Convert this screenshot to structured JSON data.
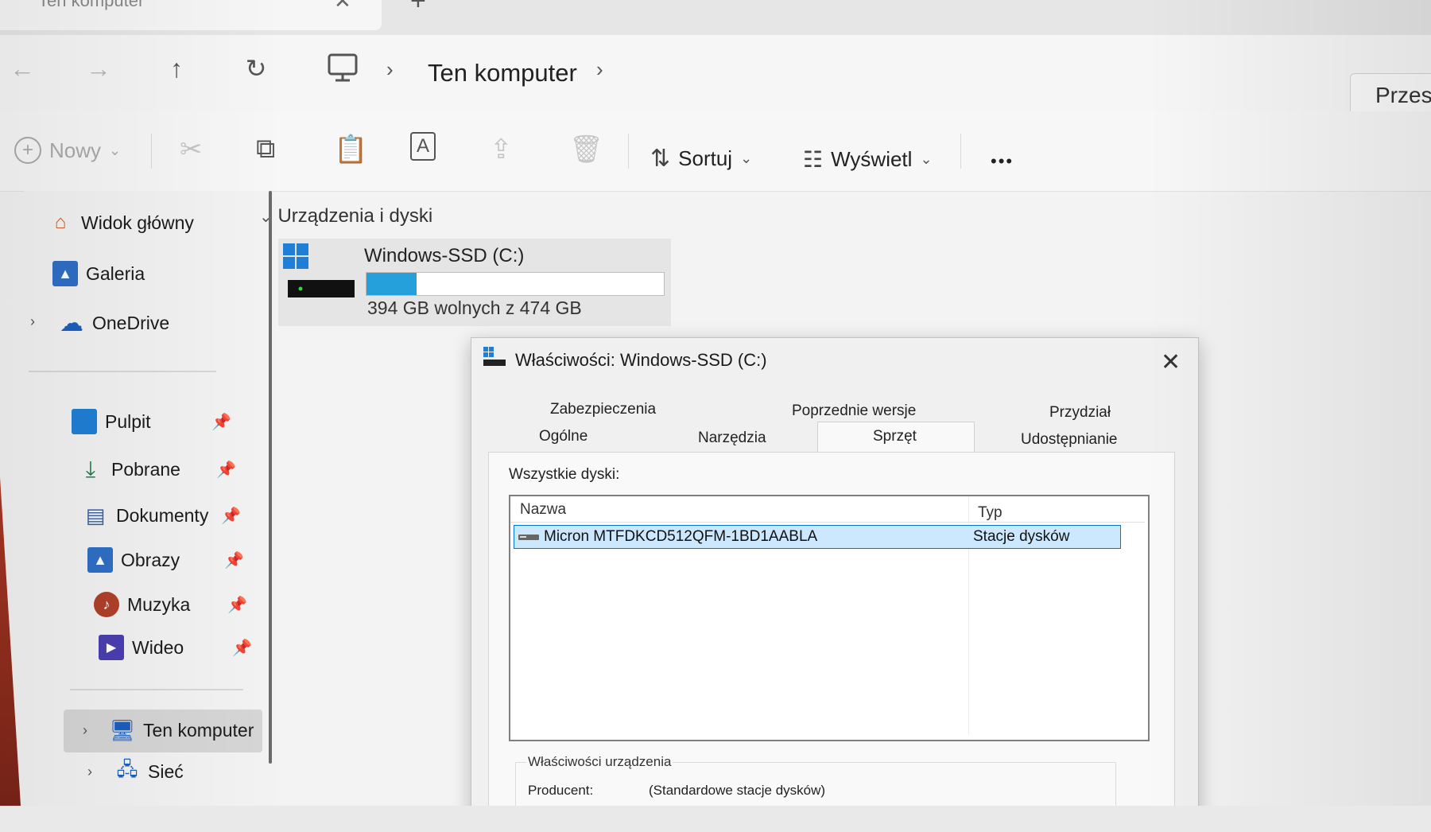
{
  "window": {
    "tab_title": "Ten komputer",
    "tab_close": "✕",
    "tab_add": "+"
  },
  "nav": {
    "back": "←",
    "forward": "→",
    "up": "↑",
    "refresh": "↻",
    "breadcrumb_sep": "›",
    "breadcrumb_label": "Ten komputer",
    "search_placeholder": "Przesz"
  },
  "commands": {
    "new_label": "Nowy",
    "sort_label": "Sortuj",
    "view_label": "Wyświetl",
    "more_label": "•••",
    "chevron": "⌄"
  },
  "sidebar": {
    "top": [
      {
        "label": "Widok główny",
        "icon": "home-icon"
      },
      {
        "label": "Galeria",
        "icon": "gallery-icon"
      },
      {
        "label": "OneDrive",
        "icon": "cloud-icon"
      }
    ],
    "pinned": [
      {
        "label": "Pulpit",
        "icon": "desktop-folder-icon"
      },
      {
        "label": "Pobrane",
        "icon": "download-icon"
      },
      {
        "label": "Dokumenty",
        "icon": "documents-icon"
      },
      {
        "label": "Obrazy",
        "icon": "pictures-icon"
      },
      {
        "label": "Muzyka",
        "icon": "music-icon"
      },
      {
        "label": "Wideo",
        "icon": "video-icon"
      }
    ],
    "bottom": [
      {
        "label": "Ten komputer",
        "icon": "computer-icon"
      },
      {
        "label": "Sieć",
        "icon": "network-icon"
      }
    ],
    "pin_glyph": "📌",
    "expand_glyph": "›"
  },
  "main": {
    "section_title": "Urządzenia i dyski",
    "section_chevron": "⌄",
    "drive": {
      "name": "Windows-SSD (C:)",
      "free_text": "394 GB wolnych z 474 GB",
      "used_fraction": 0.169,
      "bar_color": "#26a0da"
    }
  },
  "dialog": {
    "title": "Właściwości: Windows-SSD (C:)",
    "close": "✕",
    "tabs_row1": [
      "Zabezpieczenia",
      "Poprzednie wersje",
      "Przydział"
    ],
    "tabs_row2": [
      "Ogólne",
      "Narzędzia",
      "Sprzęt",
      "Udostępnianie"
    ],
    "active_tab": "Sprzęt",
    "all_disks_label": "Wszystkie dyski:",
    "columns": [
      "Nazwa",
      "Typ"
    ],
    "rows": [
      {
        "name": "Micron MTFDKCD512QFM-1BD1AABLA",
        "type": "Stacje dysków"
      }
    ],
    "device_props_title": "Właściwości urządzenia",
    "props": [
      {
        "key": "Producent:",
        "value": "(Standardowe stacje dysków)"
      }
    ],
    "selection_color": "#cce8ff"
  }
}
